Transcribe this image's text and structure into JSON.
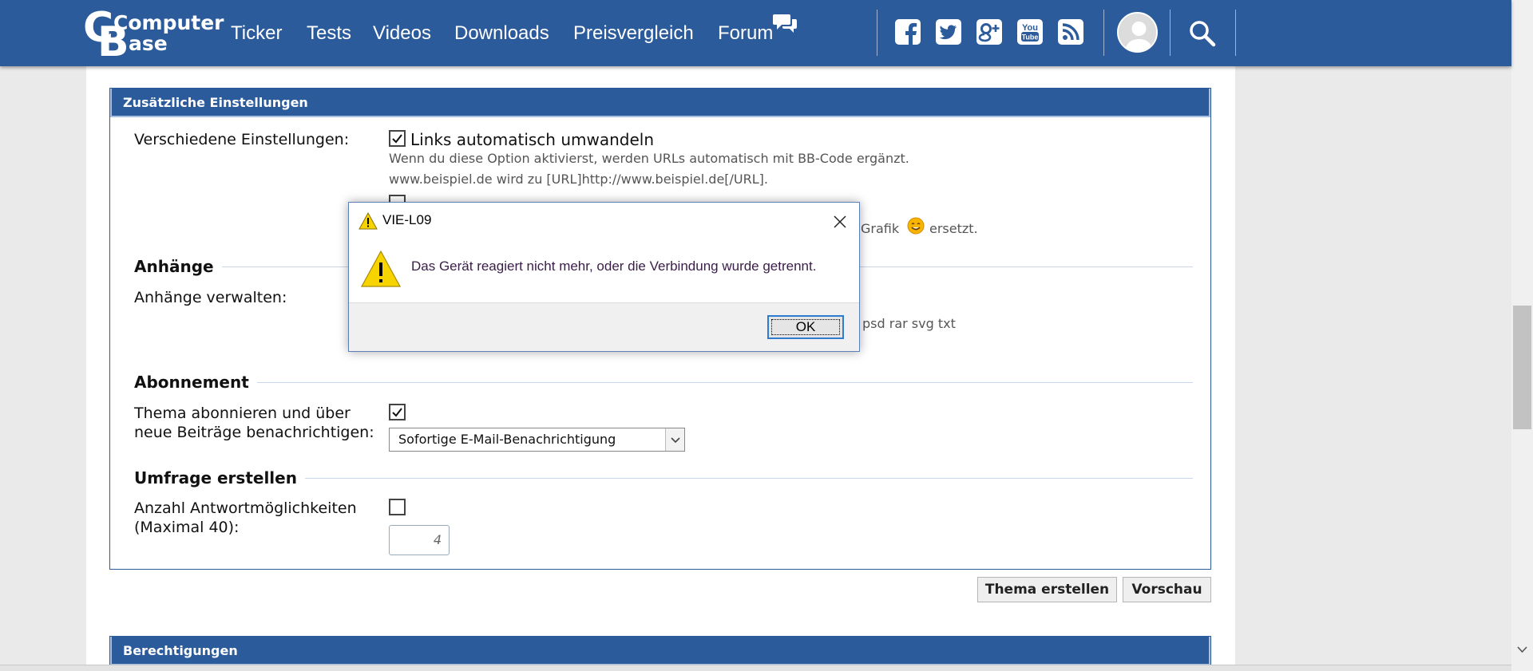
{
  "nav": {
    "logo": {
      "top": "Computer",
      "bottom": "Base"
    },
    "links": [
      "Ticker",
      "Tests",
      "Videos",
      "Downloads",
      "Preisvergleich",
      "Forum"
    ],
    "social_icons": [
      "facebook-icon",
      "twitter-icon",
      "google-plus-icon",
      "youtube-icon",
      "rss-icon"
    ],
    "brand_color": "#2c5b9c"
  },
  "settings": {
    "title": "Zusätzliche Einstellungen",
    "misc_label": "Verschiedene Einstellungen:",
    "auto_links": {
      "checked": true,
      "label": "Links automatisch umwandeln",
      "hint1": "Wenn du diese Option aktivierst, werden URLs automatisch mit BB-Code ergänzt.",
      "hint2": "www.beispiel.de wird zu [URL]http://www.beispiel.de[/URL]."
    },
    "smilies_hint_tail_1": "Grafik",
    "smilies_hint_tail_2": "ersetzt.",
    "attachments": {
      "title": "Anhänge",
      "manage_label": "Anhänge verwalten:",
      "types_tail": "psd rar svg txt"
    },
    "subscription": {
      "title": "Abonnement",
      "label_line1": "Thema abonnieren und über",
      "label_line2": "neue Beiträge benachrichtigen:",
      "checked": true,
      "select_value": "Sofortige E-Mail-Benachrichtigung"
    },
    "poll": {
      "title": "Umfrage erstellen",
      "label_line1": "Anzahl Antwortmöglichkeiten",
      "label_line2": "(Maximal 40):",
      "checked": false,
      "count_placeholder": "4"
    }
  },
  "actions": {
    "create": "Thema erstellen",
    "preview": "Vorschau"
  },
  "permissions": {
    "title": "Berechtigungen"
  },
  "dialog": {
    "title": "VIE-L09",
    "message": "Das Gerät reagiert nicht mehr, oder die Verbindung wurde getrennt.",
    "ok": "OK"
  }
}
